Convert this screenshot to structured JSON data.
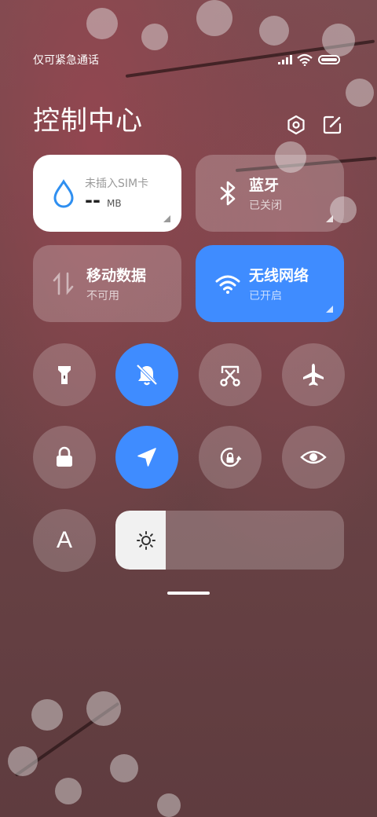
{
  "status_bar": {
    "text": "仅可紧急通话"
  },
  "header": {
    "title": "控制中心"
  },
  "tiles": {
    "data_usage": {
      "title": "未插入SIM卡",
      "value": "--",
      "unit": "MB"
    },
    "bluetooth": {
      "title": "蓝牙",
      "status": "已关闭"
    },
    "mobile_data": {
      "title": "移动数据",
      "status": "不可用"
    },
    "wifi": {
      "title": "无线网络",
      "status": "已开启"
    }
  },
  "toggles": [
    {
      "name": "flashlight",
      "active": false
    },
    {
      "name": "silent",
      "active": true
    },
    {
      "name": "screenshot",
      "active": false
    },
    {
      "name": "airplane-mode",
      "active": false
    },
    {
      "name": "lock-screen",
      "active": false
    },
    {
      "name": "location",
      "active": true
    },
    {
      "name": "rotation-lock",
      "active": false
    },
    {
      "name": "reading-mode",
      "active": false
    },
    {
      "name": "auto-brightness",
      "label": "A",
      "active": false
    }
  ],
  "brightness": {
    "level": 0.22
  },
  "colors": {
    "accent": "#3f8cff",
    "tile_light": "#ffffff"
  }
}
